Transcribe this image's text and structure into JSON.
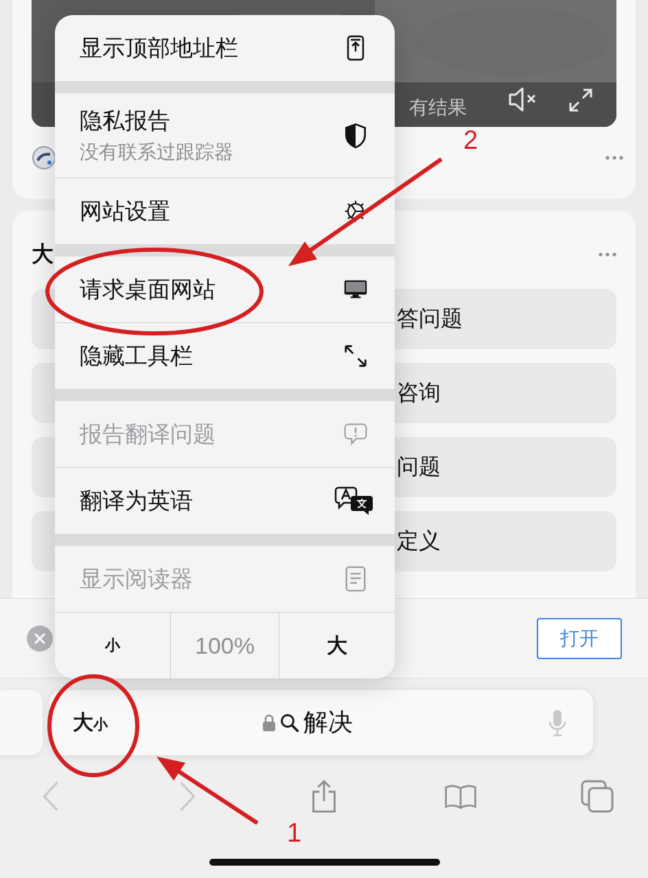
{
  "video": {
    "caption": "有结果"
  },
  "section": {
    "heading": "大"
  },
  "suggestions": [
    {
      "label": "答问题"
    },
    {
      "label": "咨询"
    },
    {
      "label": "问题"
    },
    {
      "label": "定义"
    }
  ],
  "banner": {
    "open_button": "打开"
  },
  "address_bar": {
    "text_size_large": "大",
    "text_size_small": "小",
    "query": "解决"
  },
  "toolbar": {
    "back_disabled": true,
    "forward_disabled": true
  },
  "menu": {
    "groups": [
      [
        {
          "label": "显示顶部地址栏",
          "disabled": false
        }
      ],
      [
        {
          "label": "隐私报告",
          "subtitle": "没有联系过跟踪器",
          "disabled": false
        },
        {
          "label": "网站设置",
          "disabled": false
        }
      ],
      [
        {
          "label": "请求桌面网站",
          "disabled": false
        },
        {
          "label": "隐藏工具栏",
          "disabled": false
        }
      ],
      [
        {
          "label": "报告翻译问题",
          "disabled": true
        },
        {
          "label": "翻译为英语",
          "disabled": false
        }
      ],
      [
        {
          "label": "显示阅读器",
          "disabled": true
        }
      ]
    ],
    "zoom": {
      "smaller": "小",
      "level": "100%",
      "larger": "大"
    }
  },
  "annotations": [
    {
      "label": "2"
    },
    {
      "label": "1"
    }
  ]
}
